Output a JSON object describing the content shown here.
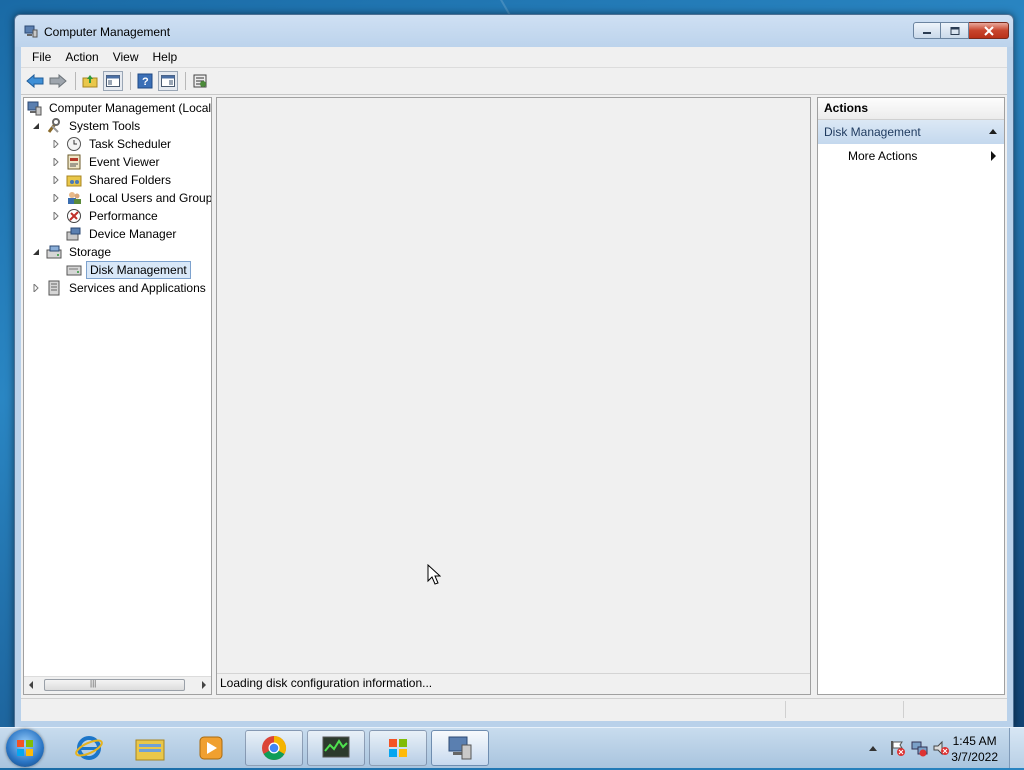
{
  "window": {
    "title": "Computer Management"
  },
  "menu": {
    "items": [
      "File",
      "Action",
      "View",
      "Help"
    ]
  },
  "tree": {
    "root": "Computer Management (Local",
    "system_tools": "System Tools",
    "task_scheduler": "Task Scheduler",
    "event_viewer": "Event Viewer",
    "shared_folders": "Shared Folders",
    "local_users": "Local Users and Groups",
    "performance": "Performance",
    "device_manager": "Device Manager",
    "storage": "Storage",
    "disk_management": "Disk Management",
    "services": "Services and Applications"
  },
  "center": {
    "status": "Loading disk configuration information..."
  },
  "actions": {
    "header": "Actions",
    "section": "Disk Management",
    "more": "More Actions"
  },
  "taskbar": {
    "time": "1:45 AM",
    "date": "3/7/2022"
  },
  "colors": {
    "selection": "#d9e8f8",
    "actions_section": "#c4d8ee",
    "title_bar": "#bcd3ec"
  }
}
